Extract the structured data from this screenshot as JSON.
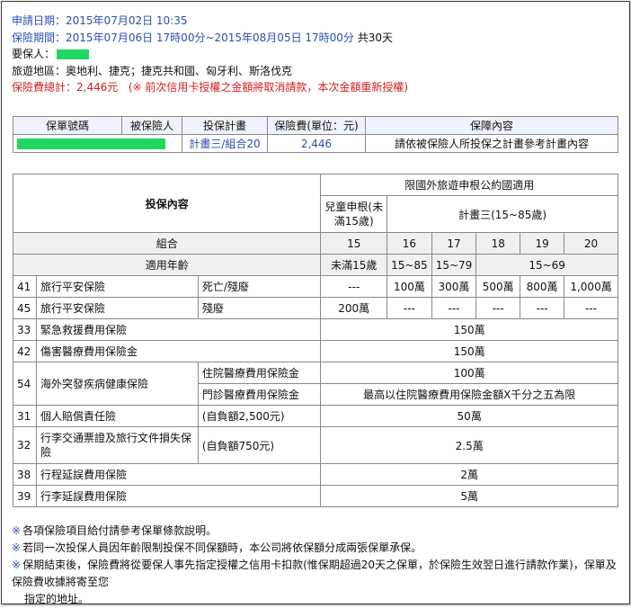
{
  "info": {
    "apply_date_label": "申請日期：",
    "apply_date": "2015年07月02日 10:35",
    "period_label": "保險期間：",
    "period": "2015年07月06日 17時00分~2015年08月05日 17時00分",
    "period_days": "共30天",
    "insurer_label": "要保人：",
    "region_label": "旅遊地區：",
    "region": "奧地利、捷克；捷克共和國、匈牙利、斯洛伐克",
    "premium_total_label": "保險費總計：",
    "premium_total": "2,446元",
    "premium_note": "(※ 前次信用卡授權之金額將取消請款，本次金額重新授權)"
  },
  "policy_table": {
    "headers": [
      "保單號碼",
      "被保險人",
      "投保計畫",
      "保險費(單位：元)",
      "保障內容"
    ],
    "plan": "計畫三/組合20",
    "premium": "2,446",
    "coverage_note": "請依被保險人所投保之計畫參考計畫內容"
  },
  "coverage_table": {
    "title_left": "投保內容",
    "title_right": "限國外旅遊申根公約國適用",
    "child_col": "兒童申根(未滿15歲)",
    "plan_col": "計畫三(15~85歲)",
    "combo_label": "組合",
    "combos": [
      "15",
      "16",
      "17",
      "18",
      "19",
      "20"
    ],
    "age_label": "適用年齡",
    "ages": [
      "未滿15歲",
      "15~85",
      "15~79",
      "15~69"
    ],
    "rows": {
      "r41": {
        "code": "41",
        "name": "旅行平安保險",
        "sub": "死亡/殘廢",
        "vals": [
          "---",
          "100萬",
          "300萬",
          "500萬",
          "800萬",
          "1,000萬"
        ]
      },
      "r45": {
        "code": "45",
        "name": "旅行平安保險",
        "sub": "殘廢",
        "vals": [
          "200萬",
          "---",
          "---",
          "---",
          "---",
          "---"
        ]
      },
      "r33": {
        "code": "33",
        "name": "緊急救援費用保險",
        "val": "150萬"
      },
      "r42": {
        "code": "42",
        "name": "傷害醫療費用保險金",
        "val": "150萬"
      },
      "r54": {
        "code": "54",
        "name": "海外突發疾病健康保險",
        "sub1": "住院醫療費用保險金",
        "val1": "100萬",
        "sub2": "門診醫療費用保險金",
        "val2": "最高以住院醫療費用保險金額X千分之五為限"
      },
      "r31": {
        "code": "31",
        "name": "個人賠償責任險",
        "sub": "(自負額2,500元)",
        "val": "50萬"
      },
      "r32": {
        "code": "32",
        "name": "行李交通票證及旅行文件損失保險",
        "sub": "(自負額750元)",
        "val": "2.5萬"
      },
      "r38": {
        "code": "38",
        "name": "行程延誤費用保險",
        "val": "2萬"
      },
      "r39": {
        "code": "39",
        "name": "行李延誤費用保險",
        "val": "5萬"
      }
    }
  },
  "notes": {
    "star": "※",
    "n1": "各項保險項目給付請參考保單條款說明。",
    "n2": "若同一次投保人員因年齡限制投保不同保額時，本公司將依保額分成兩張保單承保。",
    "n3": "保期結束後，保險費將從要保人事先指定授權之信用卡扣款(惟保期超過20天之保單，於保險生效翌日進行請款作業)，保單及保險費收據將寄至您",
    "n3b": "指定的地址。"
  }
}
